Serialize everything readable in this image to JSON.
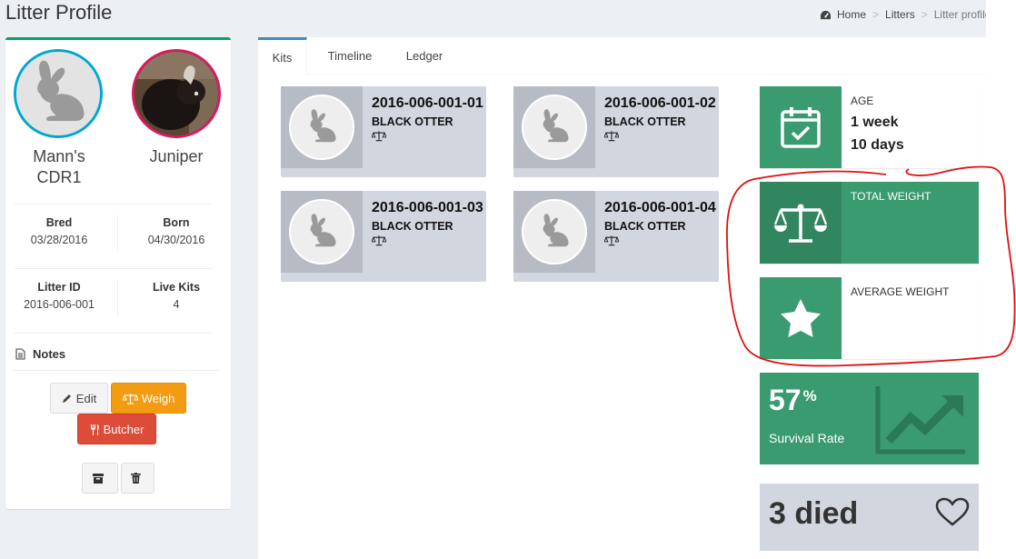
{
  "header": {
    "title": "Litter Profile",
    "breadcrumb": [
      "Home",
      "Litters",
      "Litter profile"
    ]
  },
  "profile": {
    "sire_name": "Mann's CDR1",
    "dam_name": "Juniper",
    "bred_label": "Bred",
    "bred_value": "03/28/2016",
    "born_label": "Born",
    "born_value": "04/30/2016",
    "litter_id_label": "Litter ID",
    "litter_id_value": "2016-006-001",
    "live_kits_label": "Live Kits",
    "live_kits_value": "4",
    "notes_label": "Notes",
    "edit_label": "Edit",
    "weigh_label": "Weigh",
    "butcher_label": "Butcher"
  },
  "tabs": [
    {
      "label": "Kits",
      "active": true
    },
    {
      "label": "Timeline",
      "active": false
    },
    {
      "label": "Ledger",
      "active": false
    }
  ],
  "kits": [
    {
      "id": "2016-006-001-01",
      "breed": "BLACK OTTER"
    },
    {
      "id": "2016-006-001-02",
      "breed": "BLACK OTTER"
    },
    {
      "id": "2016-006-001-03",
      "breed": "BLACK OTTER"
    },
    {
      "id": "2016-006-001-04",
      "breed": "BLACK OTTER"
    }
  ],
  "age": {
    "label": "AGE",
    "line1": "1 week",
    "line2": "10 days"
  },
  "total_weight": {
    "label": "TOTAL WEIGHT"
  },
  "average_weight": {
    "label": "AVERAGE WEIGHT"
  },
  "survival": {
    "value": "57",
    "unit": "%",
    "label": "Survival Rate"
  },
  "died": {
    "text": "3 died"
  },
  "colors": {
    "green": "#3a9a70",
    "orange": "#f39c12",
    "red": "#dd4b39",
    "annotation": "#e01010"
  }
}
